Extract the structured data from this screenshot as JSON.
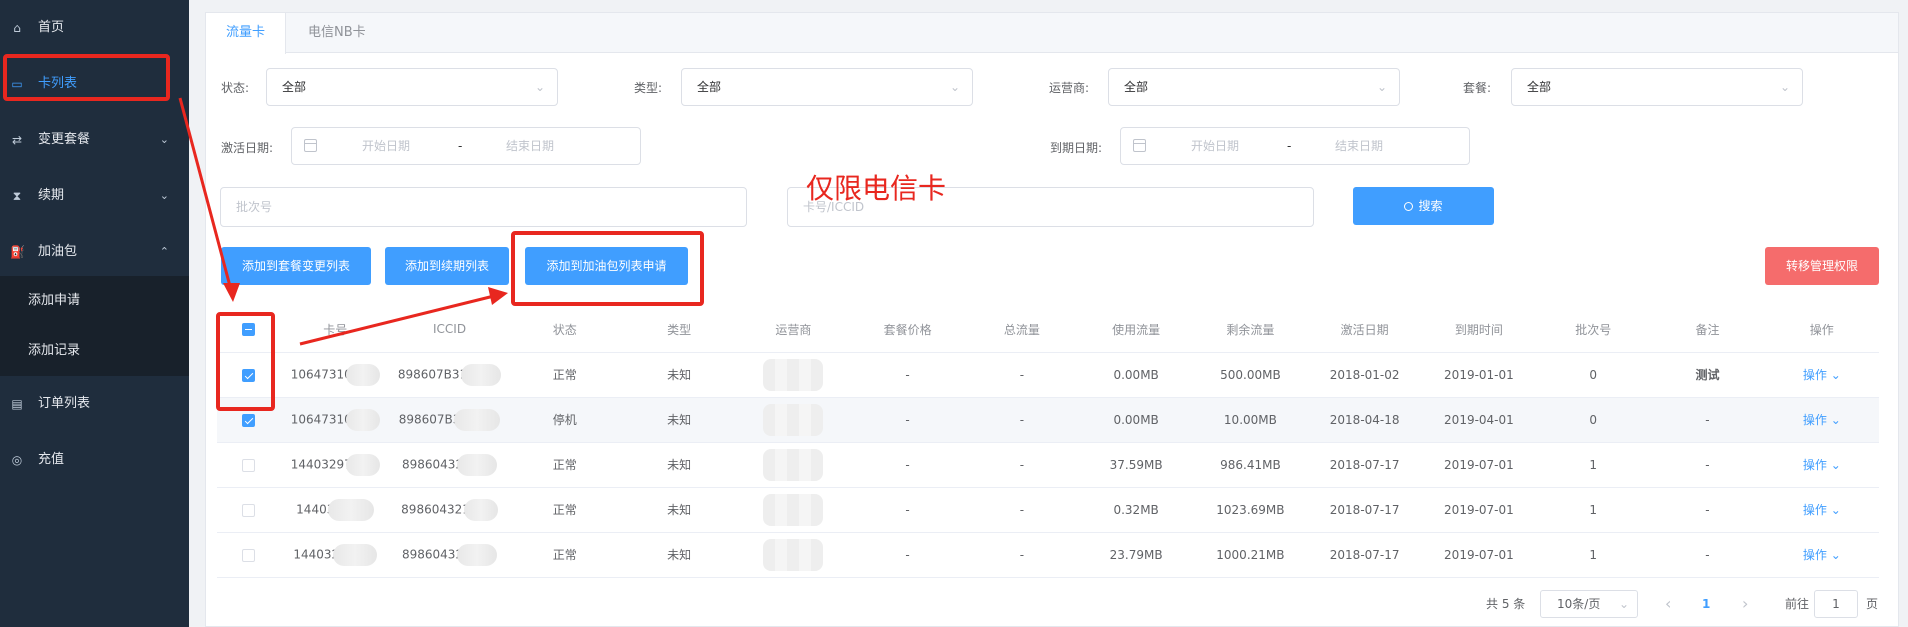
{
  "sidebar": {
    "items": [
      {
        "label": "首页",
        "icon": "home-icon"
      },
      {
        "label": "卡列表",
        "icon": "card-icon"
      },
      {
        "label": "变更套餐",
        "icon": "switch-icon"
      },
      {
        "label": "续期",
        "icon": "hourglass-icon"
      },
      {
        "label": "加油包",
        "icon": "fuel-icon"
      },
      {
        "label": "订单列表",
        "icon": "order-icon"
      },
      {
        "label": "充值",
        "icon": "recharge-icon"
      }
    ],
    "sub_items": [
      "添加申请",
      "添加记录"
    ]
  },
  "tabs": [
    "流量卡",
    "电信NB卡"
  ],
  "filters": {
    "status_label": "状态:",
    "status_value": "全部",
    "type_label": "类型:",
    "type_value": "全部",
    "carrier_label": "运营商:",
    "carrier_value": "全部",
    "plan_label": "套餐:",
    "plan_value": "全部",
    "activate_label": "激活日期:",
    "expire_label": "到期日期:",
    "start_placeholder": "开始日期",
    "end_placeholder": "结束日期",
    "range_sep": "-",
    "batch_placeholder": "批次号",
    "card_placeholder": "卡号/ICCID",
    "search_label": "搜索"
  },
  "actions": {
    "add_plan": "添加到套餐变更列表",
    "add_renew": "添加到续期列表",
    "add_fuel": "添加到加油包列表申请",
    "transfer": "转移管理权限"
  },
  "annotation": "仅限电信卡",
  "table": {
    "headers": [
      "卡号",
      "ICCID",
      "状态",
      "类型",
      "运营商",
      "套餐价格",
      "总流量",
      "使用流量",
      "剩余流量",
      "激活日期",
      "到期时间",
      "批次号",
      "备注",
      "操作"
    ],
    "rows": [
      {
        "card": "10647310",
        "iccid": "898607B31",
        "status": "正常",
        "type": "未知",
        "price": "-",
        "total": "-",
        "used": "0.00MB",
        "remain": "500.00MB",
        "activated": "2018-01-02",
        "expire": "2019-01-01",
        "batch": "0",
        "note": "测试",
        "op": "操作",
        "checked": true
      },
      {
        "card": "10647310",
        "iccid": "898607B3",
        "status": "停机",
        "type": "未知",
        "price": "-",
        "total": "-",
        "used": "0.00MB",
        "remain": "10.00MB",
        "activated": "2018-04-18",
        "expire": "2019-04-01",
        "batch": "0",
        "note": "-",
        "op": "操作",
        "checked": true
      },
      {
        "card": "14403297",
        "iccid": "89860432",
        "status": "正常",
        "type": "未知",
        "price": "-",
        "total": "-",
        "used": "37.59MB",
        "remain": "986.41MB",
        "activated": "2018-07-17",
        "expire": "2019-07-01",
        "batch": "1",
        "note": "-",
        "op": "操作",
        "checked": false
      },
      {
        "card": "14403",
        "iccid": "898604321",
        "status": "正常",
        "type": "未知",
        "price": "-",
        "total": "-",
        "used": "0.32MB",
        "remain": "1023.69MB",
        "activated": "2018-07-17",
        "expire": "2019-07-01",
        "batch": "1",
        "note": "-",
        "op": "操作",
        "checked": false
      },
      {
        "card": "144032",
        "iccid": "89860432",
        "status": "正常",
        "type": "未知",
        "price": "-",
        "total": "-",
        "used": "23.79MB",
        "remain": "1000.21MB",
        "activated": "2018-07-17",
        "expire": "2019-07-01",
        "batch": "1",
        "note": "-",
        "op": "操作",
        "checked": false
      }
    ]
  },
  "pagination": {
    "total": "共 5 条",
    "page_size": "10条/页",
    "current_page": "1",
    "goto_label": "前往",
    "goto_value": "1",
    "page_suffix": "页",
    "prev": "‹",
    "next": "›"
  },
  "colors": {
    "accent": "#409eff",
    "sidebar": "#1f2d3d",
    "annotation": "#e8271f",
    "danger": "#f56c6c"
  }
}
